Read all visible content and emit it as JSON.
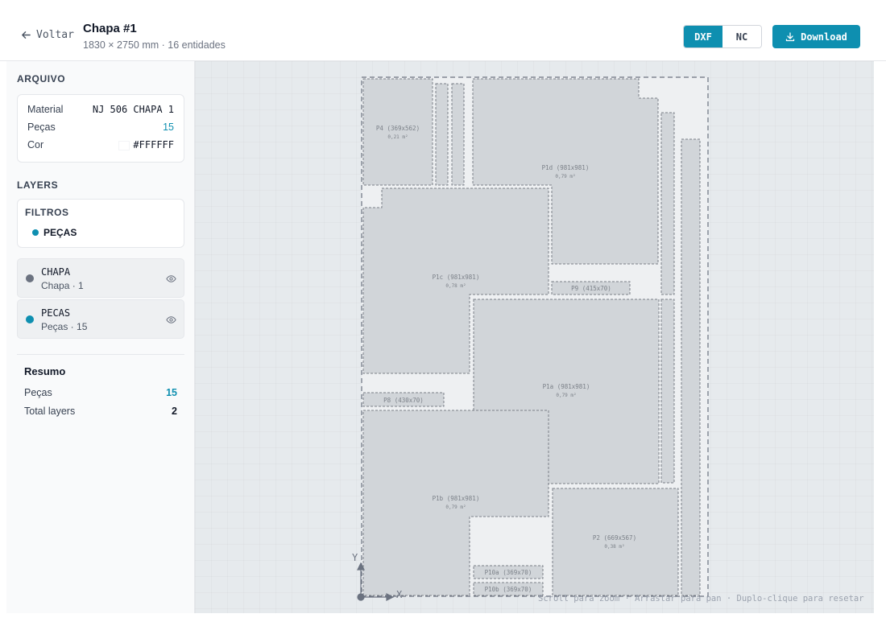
{
  "header": {
    "back_label": "Voltar",
    "title": "Chapa #1",
    "subtitle": "1830 × 2750 mm · 16 entidades",
    "format_options": [
      "DXF",
      "NC"
    ],
    "active_format": "DXF",
    "download_label": "Download",
    "accent_color": "#0e8fb0"
  },
  "sidebar": {
    "arquivo_label": "ARQUIVO",
    "arquivo": {
      "material_label": "Material",
      "material_value": "NJ 506 CHAPA 1",
      "pecas_label": "Peças",
      "pecas_value": "15",
      "cor_label": "Cor",
      "cor_value": "#FFFFFF"
    },
    "layers_label": "LAYERS",
    "filtros_label": "FILTROS",
    "filtro_chip": "PEÇAS",
    "layers": [
      {
        "name": "CHAPA",
        "sub": "Chapa · 1",
        "color": "#6b7280"
      },
      {
        "name": "PECAS",
        "sub": "Peças · 15",
        "color": "#0e8fb0"
      }
    ],
    "resumo": {
      "title": "Resumo",
      "pecas_label": "Peças",
      "pecas_value": "15",
      "total_label": "Total layers",
      "total_value": "2"
    }
  },
  "canvas": {
    "hint": "Scroll para zoom · Arrastar para pan · Duplo-clique para resetar",
    "axis_x": "X",
    "axis_y": "Y",
    "sheet": {
      "width_mm": 1830,
      "height_mm": 2750
    },
    "parts": {
      "p4": {
        "label": "P4 (369x562)",
        "area": "0,21 m²"
      },
      "p1d": {
        "label": "P1d (981x981)",
        "area": "0,79 m²"
      },
      "p1c": {
        "label": "P1c (981x981)",
        "area": "0,78 m²"
      },
      "p9": {
        "label": "P9 (415x70)"
      },
      "p1a": {
        "label": "P1a (981x981)",
        "area": "0,79 m²"
      },
      "p8": {
        "label": "P8 (430x70)"
      },
      "p1b": {
        "label": "P1b (981x981)",
        "area": "0,79 m²"
      },
      "p2": {
        "label": "P2 (669x567)",
        "area": "0,38 m²"
      },
      "p10a": {
        "label": "P10a (369x70)"
      },
      "p10b": {
        "label": "P10b (369x70)"
      }
    }
  }
}
